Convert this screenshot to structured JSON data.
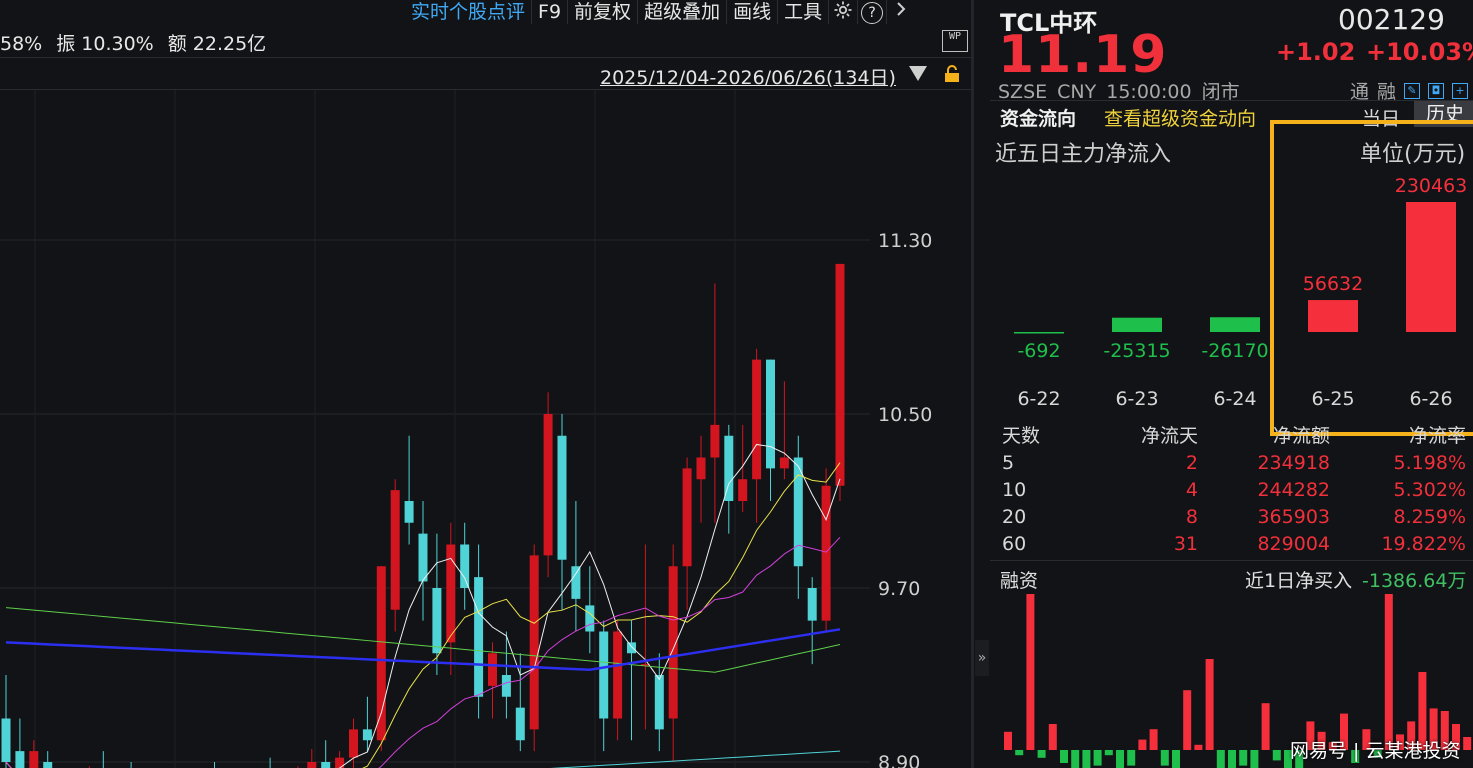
{
  "toolbar": {
    "items": [
      "实时个股点评",
      "F9",
      "前复权",
      "超级叠加",
      "画线",
      "工具"
    ],
    "settings_icon": "gear-icon",
    "help_icon": "help-icon",
    "more_icon": "chevron-right-icon"
  },
  "stats": {
    "item0": "58%",
    "item1": "振 10.30%",
    "item2": "额 22.25亿"
  },
  "wp_icon_text": "WP",
  "date_range": "2025/12/04-2026/06/26(134日)",
  "price_axis": [
    "11.30",
    "10.50",
    "9.70",
    "8.90"
  ],
  "stock": {
    "name": "TCL中环",
    "code": "002129",
    "price": "11.19",
    "change": "+1.02",
    "change_pct": "+10.03%",
    "exchange": "SZSE",
    "currency": "CNY",
    "time": "15:00:00",
    "status": "闭市",
    "tag1": "通",
    "tag2": "融"
  },
  "capital_tabs": {
    "flow": "资金流向",
    "super": "查看超级资金动向",
    "today": "当日",
    "history": "历史"
  },
  "flow_chart": {
    "title": "近五日主力净流入",
    "unit": "单位(万元)"
  },
  "chart_data": [
    {
      "type": "bar",
      "title": "近五日主力净流入",
      "unit": "单位(万元)",
      "categories": [
        "6-22",
        "6-23",
        "6-24",
        "6-25",
        "6-26"
      ],
      "values": [
        -692,
        -25315,
        -26170,
        56632,
        230463
      ],
      "colors": {
        "positive": "#f5303c",
        "negative": "#1fbf4c"
      }
    },
    {
      "type": "candlestick",
      "ylabels": [
        "11.30",
        "10.50",
        "9.70",
        "8.90"
      ],
      "candles": [
        {
          "o": 9.1,
          "h": 9.3,
          "l": 8.5,
          "c": 8.9
        },
        {
          "o": 8.95,
          "h": 9.1,
          "l": 8.7,
          "c": 8.75
        },
        {
          "o": 8.8,
          "h": 9.0,
          "l": 8.6,
          "c": 8.95
        },
        {
          "o": 8.9,
          "h": 8.95,
          "l": 8.6,
          "c": 8.7
        },
        {
          "o": 8.7,
          "h": 8.85,
          "l": 8.6,
          "c": 8.8
        },
        {
          "o": 8.8,
          "h": 8.85,
          "l": 8.7,
          "c": 8.75
        },
        {
          "o": 8.8,
          "h": 8.88,
          "l": 8.7,
          "c": 8.85
        },
        {
          "o": 8.85,
          "h": 8.95,
          "l": 8.78,
          "c": 8.8
        },
        {
          "o": 8.8,
          "h": 8.85,
          "l": 8.72,
          "c": 8.82
        },
        {
          "o": 8.82,
          "h": 8.9,
          "l": 8.78,
          "c": 8.8
        },
        {
          "o": 8.8,
          "h": 8.85,
          "l": 8.7,
          "c": 8.76
        },
        {
          "o": 8.76,
          "h": 8.82,
          "l": 8.7,
          "c": 8.79
        },
        {
          "o": 8.79,
          "h": 8.84,
          "l": 8.7,
          "c": 8.74
        },
        {
          "o": 8.74,
          "h": 8.8,
          "l": 8.66,
          "c": 8.78
        },
        {
          "o": 8.78,
          "h": 8.86,
          "l": 8.72,
          "c": 8.83
        },
        {
          "o": 8.83,
          "h": 8.9,
          "l": 8.75,
          "c": 8.77
        },
        {
          "o": 8.77,
          "h": 8.82,
          "l": 8.68,
          "c": 8.71
        },
        {
          "o": 8.71,
          "h": 8.78,
          "l": 8.64,
          "c": 8.76
        },
        {
          "o": 8.76,
          "h": 8.86,
          "l": 8.72,
          "c": 8.84
        },
        {
          "o": 8.84,
          "h": 8.92,
          "l": 8.78,
          "c": 8.8
        },
        {
          "o": 8.8,
          "h": 8.86,
          "l": 8.74,
          "c": 8.82
        },
        {
          "o": 8.82,
          "h": 8.88,
          "l": 8.76,
          "c": 8.86
        },
        {
          "o": 8.86,
          "h": 8.96,
          "l": 8.8,
          "c": 8.9
        },
        {
          "o": 8.9,
          "h": 9.0,
          "l": 8.82,
          "c": 8.86
        },
        {
          "o": 8.86,
          "h": 8.95,
          "l": 8.78,
          "c": 8.92
        },
        {
          "o": 8.92,
          "h": 9.1,
          "l": 8.85,
          "c": 9.05
        },
        {
          "o": 9.05,
          "h": 9.2,
          "l": 8.95,
          "c": 9.0
        },
        {
          "o": 9.0,
          "h": 9.8,
          "l": 8.95,
          "c": 9.8
        },
        {
          "o": 9.6,
          "h": 10.2,
          "l": 9.5,
          "c": 10.15
        },
        {
          "o": 10.1,
          "h": 10.4,
          "l": 9.9,
          "c": 10.0
        },
        {
          "o": 9.95,
          "h": 10.1,
          "l": 9.55,
          "c": 9.73
        },
        {
          "o": 9.7,
          "h": 9.95,
          "l": 9.3,
          "c": 9.4
        },
        {
          "o": 9.45,
          "h": 10.0,
          "l": 9.3,
          "c": 9.9
        },
        {
          "o": 9.9,
          "h": 10.0,
          "l": 9.6,
          "c": 9.7
        },
        {
          "o": 9.75,
          "h": 9.9,
          "l": 9.1,
          "c": 9.2
        },
        {
          "o": 9.25,
          "h": 9.45,
          "l": 9.1,
          "c": 9.4
        },
        {
          "o": 9.3,
          "h": 9.5,
          "l": 9.1,
          "c": 9.2
        },
        {
          "o": 9.15,
          "h": 9.4,
          "l": 8.95,
          "c": 9.0
        },
        {
          "o": 9.05,
          "h": 9.9,
          "l": 8.95,
          "c": 9.85
        },
        {
          "o": 9.85,
          "h": 10.6,
          "l": 9.75,
          "c": 10.5
        },
        {
          "o": 10.4,
          "h": 10.5,
          "l": 9.6,
          "c": 9.83
        },
        {
          "o": 9.8,
          "h": 10.1,
          "l": 9.5,
          "c": 9.65
        },
        {
          "o": 9.62,
          "h": 9.8,
          "l": 9.4,
          "c": 9.5
        },
        {
          "o": 9.5,
          "h": 9.55,
          "l": 8.95,
          "c": 9.1
        },
        {
          "o": 9.1,
          "h": 9.55,
          "l": 9.0,
          "c": 9.5
        },
        {
          "o": 9.45,
          "h": 9.55,
          "l": 9.0,
          "c": 9.4
        },
        {
          "o": 9.35,
          "h": 9.9,
          "l": 9.05,
          "c": 9.35
        },
        {
          "o": 9.3,
          "h": 9.4,
          "l": 8.95,
          "c": 9.05
        },
        {
          "o": 9.1,
          "h": 9.9,
          "l": 8.9,
          "c": 9.8
        },
        {
          "o": 9.8,
          "h": 10.3,
          "l": 9.6,
          "c": 10.25
        },
        {
          "o": 10.2,
          "h": 10.4,
          "l": 10.0,
          "c": 10.3
        },
        {
          "o": 10.3,
          "h": 11.1,
          "l": 10.0,
          "c": 10.45
        },
        {
          "o": 10.4,
          "h": 10.45,
          "l": 9.95,
          "c": 10.1
        },
        {
          "o": 10.1,
          "h": 10.45,
          "l": 10.05,
          "c": 10.2
        },
        {
          "o": 10.2,
          "h": 10.8,
          "l": 10.0,
          "c": 10.75
        },
        {
          "o": 10.75,
          "h": 10.75,
          "l": 10.1,
          "c": 10.25
        },
        {
          "o": 10.25,
          "h": 10.65,
          "l": 10.2,
          "c": 10.3
        },
        {
          "o": 10.3,
          "h": 10.4,
          "l": 9.65,
          "c": 9.8
        },
        {
          "o": 9.7,
          "h": 9.75,
          "l": 9.35,
          "c": 9.55
        },
        {
          "o": 9.55,
          "h": 10.25,
          "l": 9.5,
          "c": 10.17
        },
        {
          "o": 10.17,
          "h": 11.19,
          "l": 10.1,
          "c": 11.19
        }
      ]
    },
    {
      "type": "bar",
      "title": "融资",
      "values": [
        0.07,
        -0.02,
        0.6,
        -0.03,
        0.1,
        -0.05,
        -0.08,
        -0.1,
        -0.06,
        -0.02,
        -0.1,
        -0.06,
        0.04,
        0.08,
        -0.06,
        -0.08,
        0.23,
        0.02,
        0.35,
        -0.1,
        -0.12,
        -0.06,
        -0.07,
        0.18,
        -0.04,
        -0.14,
        -0.1,
        0.11,
        0.07,
        0.03,
        0.14,
        -0.05,
        0.08,
        -0.03,
        0.6,
        0.06,
        0.11,
        0.3,
        0.16,
        0.15,
        0.1,
        0.05
      ],
      "colors": {
        "positive": "#f5303c",
        "negative": "#1fbf4c"
      }
    }
  ],
  "flow_table": {
    "headers": [
      "天数",
      "净流天",
      "净流额",
      "净流率"
    ],
    "rows": [
      [
        "5",
        "2",
        "234918",
        "5.198%"
      ],
      [
        "10",
        "4",
        "244282",
        "5.302%"
      ],
      [
        "20",
        "8",
        "365903",
        "8.259%"
      ],
      [
        "60",
        "31",
        "829004",
        "19.822%"
      ]
    ]
  },
  "financing": {
    "title": "融资",
    "net_label": "近1日净买入",
    "net_value": "-1386.64万"
  },
  "watermark": "网易号 | 云某港投资"
}
